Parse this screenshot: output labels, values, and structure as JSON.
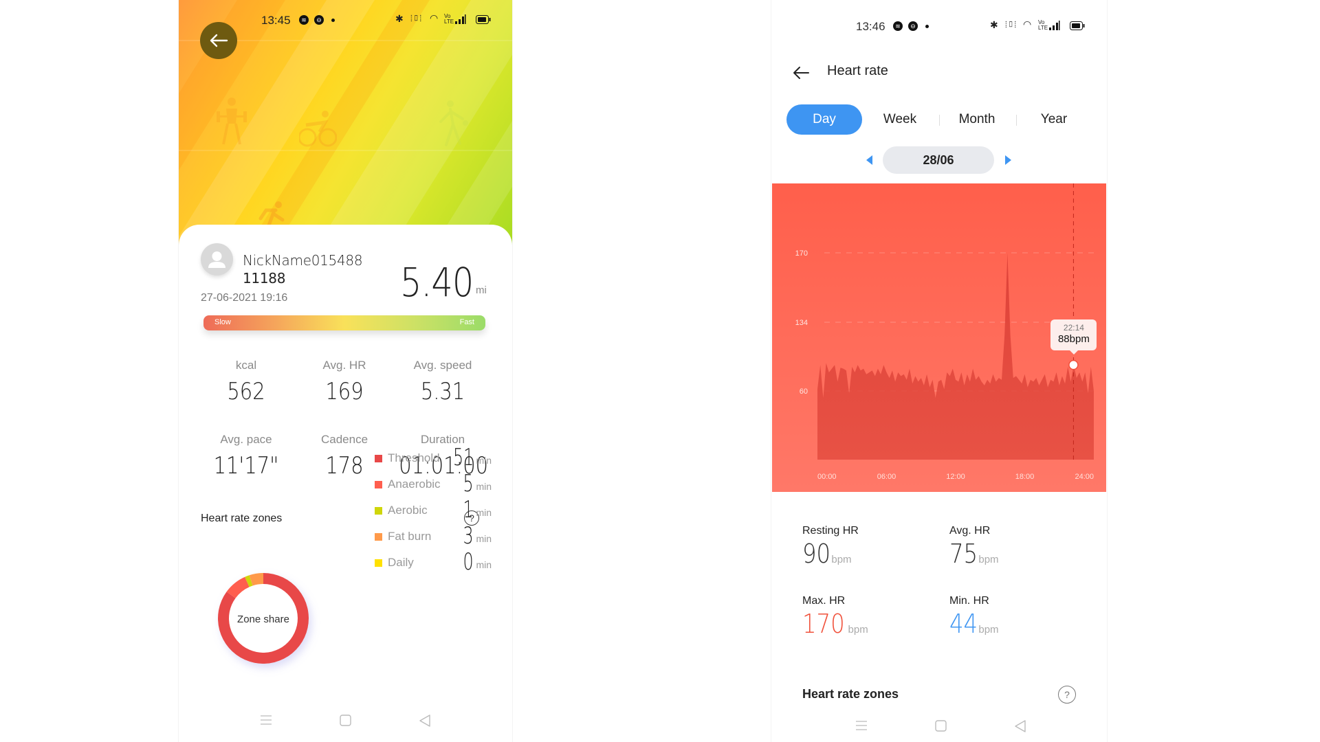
{
  "left": {
    "status_bar": {
      "time": "13:45",
      "app_icons": [
        "spotify-icon",
        "app-icon",
        "notification-dot"
      ],
      "system_icons": [
        "bluetooth-icon",
        "vibrate-icon",
        "wifi-icon",
        "volte-icon",
        "signal-icon",
        "battery-icon"
      ]
    },
    "hero": {
      "back_icon": "arrow-left-icon",
      "sport_icons": [
        "weightlifting-icon",
        "cycling-icon",
        "walking-icon",
        "running-icon"
      ]
    },
    "profile": {
      "nickname": "NickName015488",
      "id": "11188",
      "datetime": "27-06-2021 19:16",
      "avatar_icon": "user-icon"
    },
    "distance": {
      "value": "5.40",
      "unit": "mi"
    },
    "speed_bar": {
      "slow_label": "Slow",
      "fast_label": "Fast"
    },
    "stats": [
      {
        "label": "kcal",
        "value": "562"
      },
      {
        "label": "Avg. HR",
        "value": "169"
      },
      {
        "label": "Avg. speed",
        "value": "5.31"
      },
      {
        "label": "Avg. pace",
        "value": "11'17\""
      },
      {
        "label": "Cadence",
        "value": "178"
      },
      {
        "label": "Duration",
        "value": "01:01:00"
      }
    ],
    "zones": {
      "title": "Heart rate zones",
      "help_icon": "question-circle-icon",
      "donut_label": "Zone share",
      "items": [
        {
          "name": "Threshold",
          "minutes": "51",
          "unit": "min",
          "color": "#e84848"
        },
        {
          "name": "Anaerobic",
          "minutes": "5",
          "unit": "min",
          "color": "#ff5e4e"
        },
        {
          "name": "Aerobic",
          "minutes": "1",
          "unit": "min",
          "color": "#cfd60a"
        },
        {
          "name": "Fat burn",
          "minutes": "3",
          "unit": "min",
          "color": "#ff9a4a"
        },
        {
          "name": "Daily",
          "minutes": "0",
          "unit": "min",
          "color": "#ffe100"
        }
      ]
    },
    "nav": [
      "menu-icon",
      "home-square-icon",
      "back-triangle-icon"
    ]
  },
  "right": {
    "status_bar": {
      "time": "13:46"
    },
    "header": {
      "back_icon": "arrow-left-icon",
      "title": "Heart rate"
    },
    "tabs": [
      {
        "label": "Day",
        "active": true
      },
      {
        "label": "Week",
        "active": false
      },
      {
        "label": "Month",
        "active": false
      },
      {
        "label": "Year",
        "active": false
      }
    ],
    "date": {
      "label": "28/06",
      "prev_icon": "triangle-left-icon",
      "next_icon": "triangle-right-icon"
    },
    "tooltip": {
      "time": "22:14",
      "value": "88bpm"
    },
    "summary": [
      {
        "label": "Resting HR",
        "value": "90",
        "unit": "bpm",
        "color": "#333333"
      },
      {
        "label": "Avg. HR",
        "value": "75",
        "unit": "bpm",
        "color": "#333333"
      },
      {
        "label": "Max. HR",
        "value": "170",
        "unit": "bpm",
        "color": "#f0503a"
      },
      {
        "label": "Min. HR",
        "value": "44",
        "unit": "bpm",
        "color": "#3e95f2"
      }
    ],
    "zones_title": "Heart rate zones",
    "colors": {
      "accent": "#3e95f2",
      "chart_bg": "#ff6552"
    }
  },
  "chart_data": [
    {
      "type": "area",
      "title": "Heart rate (Day)",
      "xlabel": "",
      "ylabel": "bpm",
      "x_ticks": [
        "00:00",
        "06:00",
        "12:00",
        "18:00",
        "24:00"
      ],
      "y_ticks": [
        60,
        134,
        170
      ],
      "x_range_hours": [
        0,
        24
      ],
      "series": [
        {
          "name": "Heart rate",
          "x_hours": [
            0.0,
            0.25,
            0.5,
            0.75,
            1.0,
            1.25,
            1.5,
            1.75,
            2.0,
            2.25,
            2.5,
            2.75,
            3.0,
            3.25,
            3.5,
            3.75,
            4.0,
            4.25,
            4.5,
            4.75,
            5.0,
            5.25,
            5.5,
            5.75,
            6.0,
            6.25,
            6.5,
            6.75,
            7.0,
            7.25,
            7.5,
            7.75,
            8.0,
            8.25,
            8.5,
            8.75,
            9.0,
            9.25,
            9.5,
            9.75,
            10.0,
            10.25,
            10.5,
            10.75,
            11.0,
            11.25,
            11.5,
            11.75,
            12.0,
            12.25,
            12.5,
            12.75,
            13.0,
            13.25,
            13.5,
            13.75,
            14.0,
            14.25,
            14.5,
            14.75,
            15.0,
            15.25,
            15.5,
            15.75,
            16.0,
            16.25,
            16.5,
            16.75,
            17.0,
            17.25,
            17.5,
            17.75,
            18.0,
            18.25,
            18.5,
            18.75,
            19.0,
            19.25,
            19.5,
            19.75,
            20.0,
            20.25,
            20.5,
            20.75,
            21.0,
            21.25,
            21.5,
            21.75,
            22.0,
            22.25,
            22.5,
            22.75,
            23.0,
            23.25,
            23.5,
            23.75,
            24.0
          ],
          "values": [
            62,
            88,
            54,
            90,
            80,
            84,
            88,
            70,
            85,
            84,
            82,
            58,
            86,
            80,
            88,
            82,
            84,
            78,
            80,
            82,
            76,
            84,
            78,
            88,
            80,
            74,
            82,
            70,
            80,
            76,
            78,
            72,
            84,
            68,
            76,
            70,
            74,
            66,
            78,
            64,
            72,
            54,
            70,
            72,
            62,
            80,
            76,
            84,
            72,
            70,
            80,
            66,
            78,
            70,
            84,
            72,
            76,
            70,
            66,
            72,
            68,
            78,
            70,
            74,
            72,
            120,
            170,
            120,
            74,
            76,
            72,
            68,
            78,
            64,
            72,
            70,
            74,
            66,
            72,
            78,
            64,
            72,
            70,
            80,
            66,
            76,
            68,
            86,
            70,
            88,
            74,
            80,
            70,
            80,
            58,
            86,
            60
          ]
        }
      ],
      "tooltip": {
        "time": "22:14",
        "value_bpm": 88
      }
    },
    {
      "type": "pie",
      "title": "Zone share",
      "categories": [
        "Threshold",
        "Anaerobic",
        "Aerobic",
        "Fat burn",
        "Daily"
      ],
      "values": [
        51,
        5,
        1,
        3,
        0
      ],
      "unit": "min"
    }
  ]
}
